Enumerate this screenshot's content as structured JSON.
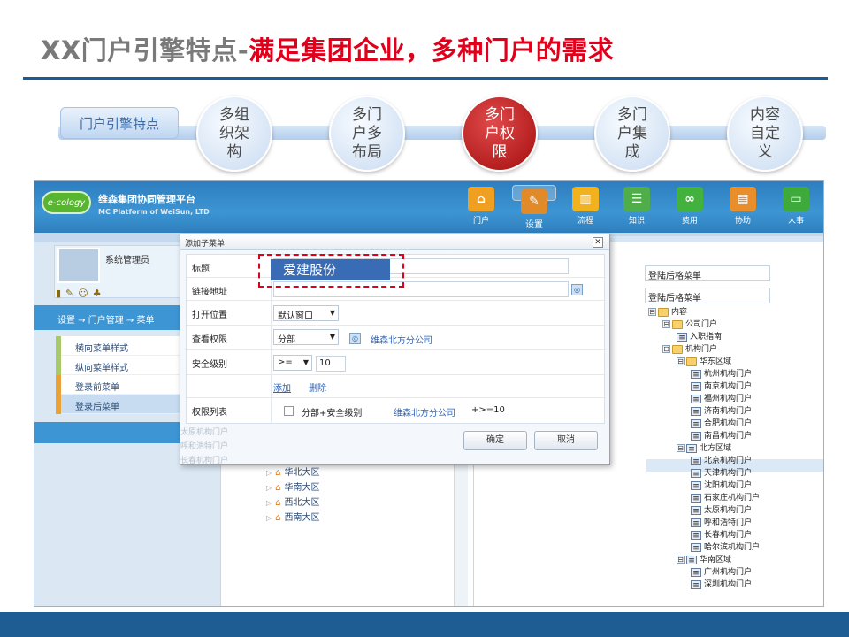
{
  "slide": {
    "title_gray": "XX门户引擎特点-",
    "title_red": "满足集团企业，多种门户的需求"
  },
  "steps": {
    "label": "门户引擎特点",
    "items": [
      "多组织架构",
      "多门户多布局",
      "多门户权限",
      "多门户集成",
      "内容自定义"
    ],
    "active_index": 2
  },
  "app": {
    "logo": "e-cology",
    "name": "维森集团协同管理平台",
    "name_en": "MC Platform of WeiSun, LTD",
    "nav": [
      "门户",
      "设置",
      "流程",
      "知识",
      "费用",
      "协助",
      "人事"
    ],
    "nav_selected": "设置"
  },
  "sidebar": {
    "user_name": "系统管理员",
    "breadcrumb": "设置 → 门户管理 → 菜单",
    "menu": [
      "横向菜单样式",
      "纵向菜单样式",
      "登录前菜单",
      "登录后菜单"
    ],
    "menu_selected": "登录后菜单"
  },
  "middle": {
    "regions": [
      "华北大区",
      "华南大区",
      "西北大区",
      "西南大区"
    ],
    "ghost_items": [
      "太原机构门户",
      "呼和浩特门户",
      "长春机构门户"
    ]
  },
  "right": {
    "input1": "登陆后格菜单",
    "input2": "登陆后格菜单",
    "tree": [
      {
        "label": "内容",
        "type": "folder",
        "level": 0,
        "toggle": "⊟"
      },
      {
        "label": "公司门户",
        "type": "folder",
        "level": 1,
        "toggle": "⊟"
      },
      {
        "label": "入职指南",
        "type": "page",
        "level": 2
      },
      {
        "label": "机构门户",
        "type": "folder",
        "level": 1,
        "toggle": "⊟"
      },
      {
        "label": "华东区域",
        "type": "folder",
        "level": 2,
        "toggle": "⊟"
      },
      {
        "label": "杭州机构门户",
        "type": "page",
        "level": 3
      },
      {
        "label": "南京机构门户",
        "type": "page",
        "level": 3
      },
      {
        "label": "福州机构门户",
        "type": "page",
        "level": 3
      },
      {
        "label": "济南机构门户",
        "type": "page",
        "level": 3
      },
      {
        "label": "合肥机构门户",
        "type": "page",
        "level": 3
      },
      {
        "label": "南昌机构门户",
        "type": "page",
        "level": 3
      },
      {
        "label": "北方区域",
        "type": "page",
        "level": 2,
        "toggle": "⊟"
      },
      {
        "label": "北京机构门户",
        "type": "page",
        "level": 3
      },
      {
        "label": "天津机构门户",
        "type": "page",
        "level": 3
      },
      {
        "label": "沈阳机构门户",
        "type": "page",
        "level": 3
      },
      {
        "label": "石家庄机构门户",
        "type": "page",
        "level": 3
      },
      {
        "label": "太原机构门户",
        "type": "page",
        "level": 3
      },
      {
        "label": "呼和浩特门户",
        "type": "page",
        "level": 3
      },
      {
        "label": "长春机构门户",
        "type": "page",
        "level": 3
      },
      {
        "label": "哈尔滨机构门户",
        "type": "page",
        "level": 3
      },
      {
        "label": "华南区域",
        "type": "page",
        "level": 2,
        "toggle": "⊟"
      },
      {
        "label": "广州机构门户",
        "type": "page",
        "level": 3
      },
      {
        "label": "深圳机构门户",
        "type": "page",
        "level": 3
      }
    ],
    "tree_selected": "北京机构门户"
  },
  "dialog": {
    "title": "添加子菜单",
    "close": "✕",
    "fields": {
      "title_label": "标题",
      "title_value": "爱建股份",
      "link_label": "链接地址",
      "link_value": "",
      "open_label": "打开位置",
      "open_value": "默认窗口",
      "perm_label": "查看权限",
      "perm_value": "分部",
      "perm_org": "维森北方分公司",
      "security_label": "安全级别",
      "security_op": ">=",
      "security_value": "10",
      "add": "添加",
      "delete": "删除",
      "list_label": "权限列表",
      "list_item": "分部+安全级别",
      "list_org": "维森北方分公司",
      "list_level": "+>=10"
    },
    "ok": "确定",
    "cancel": "取消"
  },
  "colors": {
    "accent_red": "#e0001b",
    "brand_blue": "#1e5c94",
    "app_blue": "#3d95d3"
  }
}
